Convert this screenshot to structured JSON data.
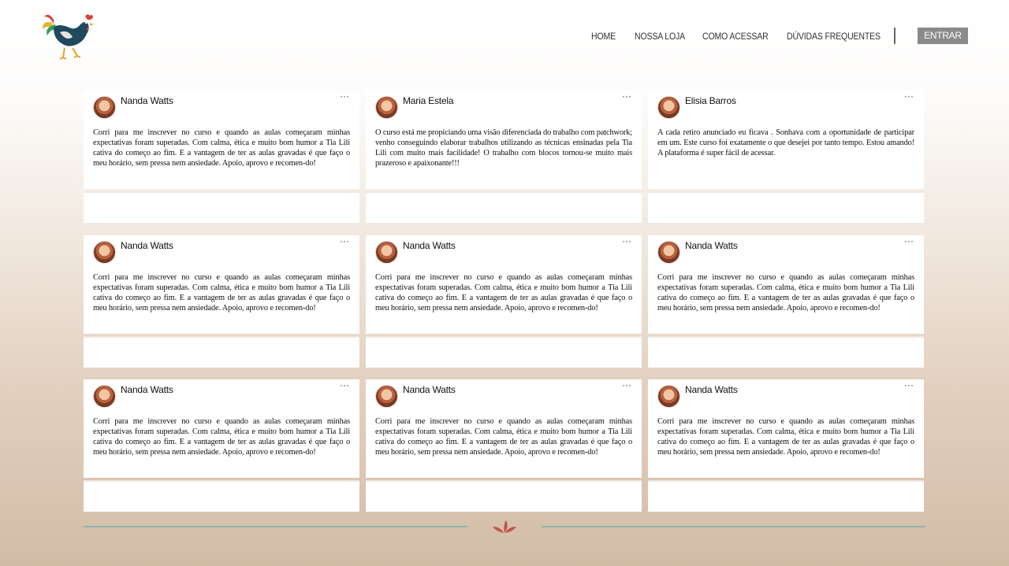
{
  "header": {
    "nav": [
      {
        "label": "HOME"
      },
      {
        "label": "NOSSA LOJA"
      },
      {
        "label": "COMO ACESSAR"
      },
      {
        "label": "DÚVIDAS FREQUENTES"
      }
    ],
    "login_label": "ENTRAR"
  },
  "testimonials": [
    {
      "name": "Nanda Watts",
      "menu": "···",
      "text": "Corri para me inscrever no curso e quando as aulas começaram minhas expectativas foram superadas. Com calma, ética e muito bom humor a Tia Lili cativa do começo ao fim. E a vantagem de ter as aulas gravadas é que faço o meu horário, sem pressa nem ansiedade. Apoio, aprovo e recomen-do!"
    },
    {
      "name": "Maria Estela",
      "menu": "···",
      "text": "O curso está me propiciando uma visão diferenciada do trabalho com patchwork; venho conseguindo elaborar trabalhos utilizando as técnicas ensinadas pela Tia Lili com muito mais facilidade! O trabalho com blocos tornou-se muito mais prazeroso e apaixonante!!!"
    },
    {
      "name": "Elisia Barros",
      "menu": "···",
      "text": "A cada retiro anunciado eu ficava          . Sonhava com a oportunidade de participar em um. Este curso foi exatamente o que desejei por tanto tempo. Estou amando! A plataforma é super fácil de acessar."
    },
    {
      "name": "Nanda Watts",
      "menu": "···",
      "text": "Corri para me inscrever no curso e quando as aulas começaram minhas expectativas foram superadas. Com calma, ética e muito bom humor a Tia Lili cativa do começo ao fim. E a vantagem de ter as aulas gravadas é que faço o meu horário, sem pressa nem ansiedade. Apoio, aprovo e recomen-do!"
    },
    {
      "name": "Nanda Watts",
      "menu": "···",
      "text": "Corri para me inscrever no curso e quando as aulas começaram minhas expectativas foram superadas. Com calma, ética e muito bom humor a Tia Lili cativa do começo ao fim. E a vantagem de ter as aulas gravadas é que faço o meu horário, sem pressa nem ansiedade. Apoio, aprovo e recomen-do!"
    },
    {
      "name": "Nanda Watts",
      "menu": "···",
      "text": "Corri para me inscrever no curso e quando as aulas começaram minhas expectativas foram superadas. Com calma, ética e muito bom humor a Tia Lili cativa do começo ao fim. E a vantagem de ter as aulas gravadas é que faço o meu horário, sem pressa nem ansiedade. Apoio, aprovo e recomen-do!"
    },
    {
      "name": "Nanda Watts",
      "menu": "···",
      "text": "Corri para me inscrever no curso e quando as aulas começaram minhas expectativas foram superadas. Com calma, ética e muito bom humor a Tia Lili cativa do começo ao fim. E a vantagem de ter as aulas gravadas é que faço o meu horário, sem pressa nem ansiedade. Apoio, aprovo e recomen-do!"
    },
    {
      "name": "Nanda Watts",
      "menu": "···",
      "text": "Corri para me inscrever no curso e quando as aulas começaram minhas expectativas foram superadas. Com calma, ética e muito bom humor a Tia Lili cativa do começo ao fim. E a vantagem de ter as aulas gravadas é que faço o meu horário, sem pressa nem ansiedade. Apoio, aprovo e recomen-do!"
    },
    {
      "name": "Nanda Watts",
      "menu": "···",
      "text": "Corri para me inscrever no curso e quando as aulas começaram minhas expectativas foram superadas. Com calma, ética e muito bom humor a Tia Lili cativa do começo ao fim. E a vantagem de ter as aulas gravadas é que faço o meu horário, sem pressa nem ansiedade. Apoio, aprovo e recomen-do!"
    }
  ],
  "colors": {
    "footer_line": "#8db5ad",
    "footer_icon": "#c0544a",
    "login_button": "#8a8a8a"
  },
  "icons": {
    "logo": "rooster-logo",
    "footer": "leaf-ornament-icon"
  }
}
